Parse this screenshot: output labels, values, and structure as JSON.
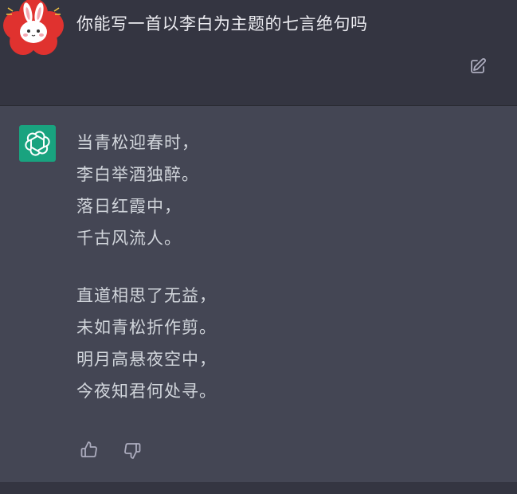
{
  "user_message": {
    "text": "你能写一首以李白为主题的七言绝句吗",
    "avatar": "rabbit-avatar",
    "edit_icon": "edit-icon"
  },
  "assistant_message": {
    "avatar": "chatgpt-logo-icon",
    "stanzas": [
      [
        "当青松迎春时，",
        "李白举酒独醉。",
        "落日红霞中，",
        "千古风流人。"
      ],
      [
        "直道相思了无益，",
        "未如青松折作剪。",
        "明月高悬夜空中，",
        "今夜知君何处寻。"
      ]
    ],
    "feedback": {
      "thumbs_up_icon": "thumbs-up-icon",
      "thumbs_down_icon": "thumbs-down-icon"
    }
  },
  "colors": {
    "user_bg": "#343541",
    "assistant_bg": "#444654",
    "gpt_green": "#19a37f",
    "avatar_red": "#e0322f",
    "text": "#d1d5db"
  }
}
